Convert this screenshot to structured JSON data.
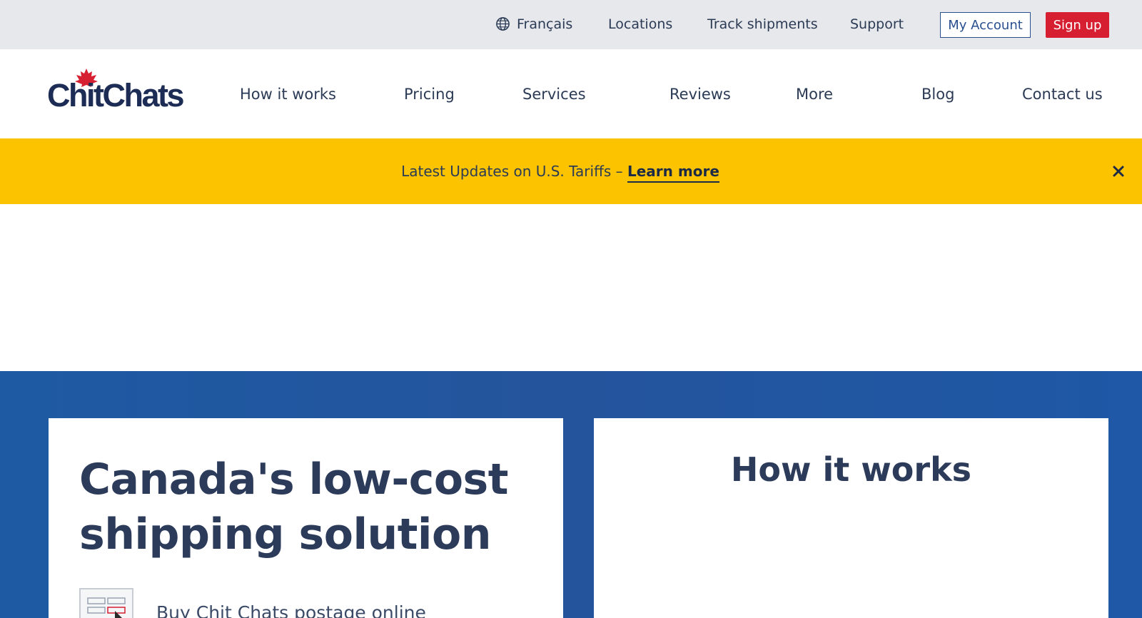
{
  "utility_bar": {
    "language": "Français",
    "locations": "Locations",
    "track": "Track shipments",
    "support": "Support",
    "my_account": "My Account",
    "sign_up": "Sign up"
  },
  "brand": {
    "logo_text": "ChitChats",
    "navy": "#1c2c55",
    "red": "#d61f31",
    "yellow": "#fbc300",
    "blue": "#24549c"
  },
  "nav": {
    "items": [
      "How it works",
      "Pricing",
      "Services",
      "Reviews",
      "More",
      "Blog",
      "Contact us"
    ]
  },
  "alert": {
    "text": "Latest Updates on U.S. Tariffs –",
    "link": "Learn more"
  },
  "hero": {
    "title": "Canada's low-cost shipping solution",
    "feature_text": "Buy Chit Chats postage online"
  },
  "how_it_works": {
    "title": "How it works"
  },
  "icons": {
    "language": "globe-icon",
    "close": "close-icon",
    "logo_mark": "maple-leaf-icon",
    "feature": "postage-label-icon"
  }
}
